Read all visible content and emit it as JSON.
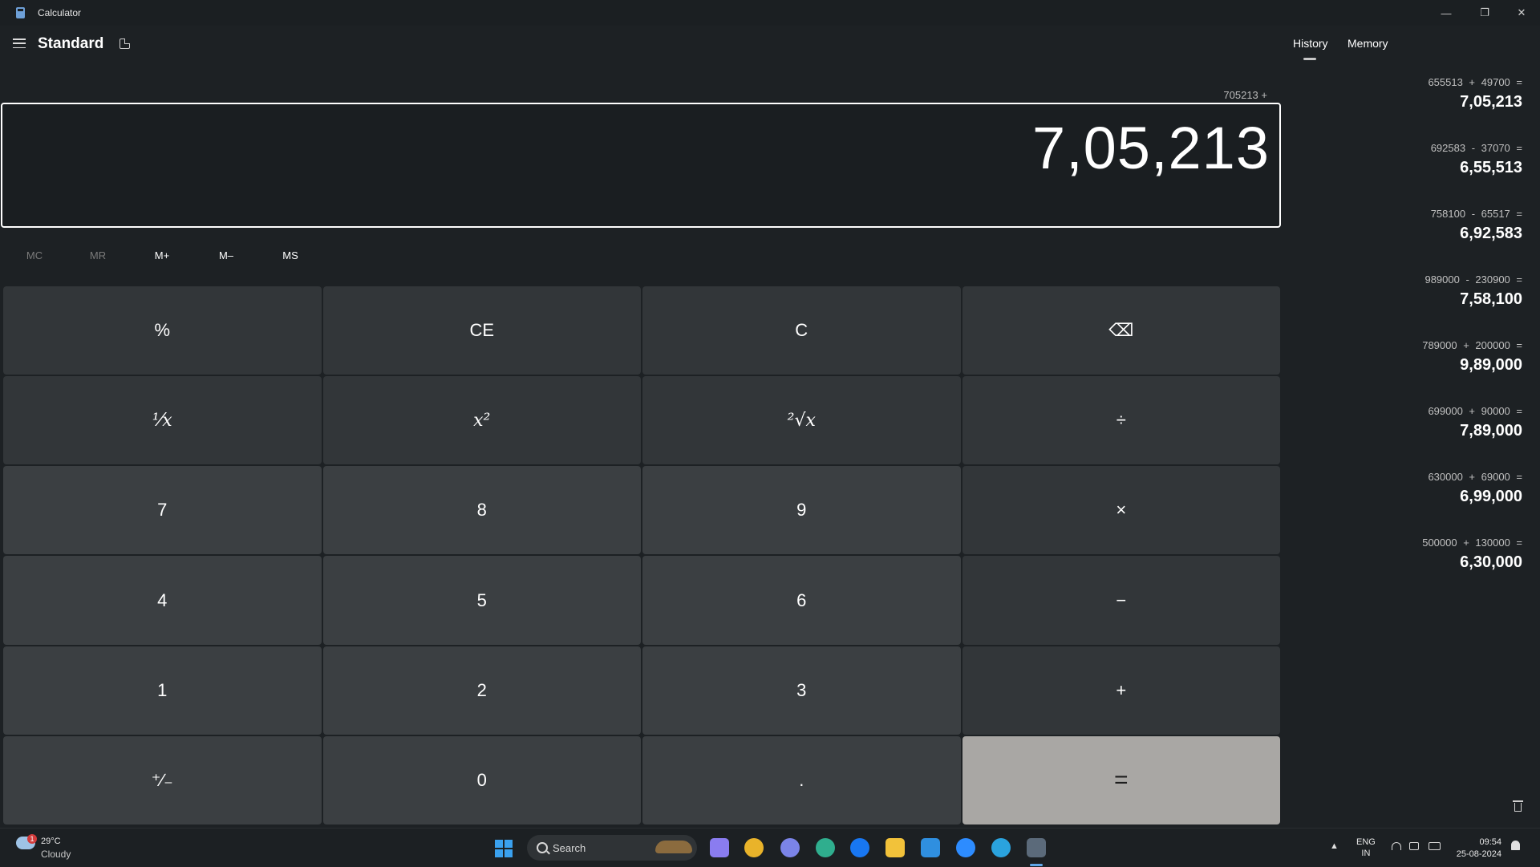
{
  "window": {
    "title": "Calculator",
    "minimize_icon": "—",
    "maximize_icon": "❐",
    "close_icon": "✕"
  },
  "header": {
    "mode": "Standard"
  },
  "display": {
    "expression": "705213 +",
    "value": "7,05,213"
  },
  "memory_buttons": [
    {
      "label": "MC",
      "enabled": false
    },
    {
      "label": "MR",
      "enabled": false
    },
    {
      "label": "M+",
      "enabled": true
    },
    {
      "label": "M–",
      "enabled": true
    },
    {
      "label": "MS",
      "enabled": true
    }
  ],
  "keys": {
    "percent": "%",
    "ce": "CE",
    "clear": "C",
    "backspace": "⌫",
    "reciprocal": "¹⁄x",
    "square": "x²",
    "sqrt": "²√x",
    "divide": "÷",
    "seven": "7",
    "eight": "8",
    "nine": "9",
    "multiply": "×",
    "four": "4",
    "five": "5",
    "six": "6",
    "minus": "−",
    "one": "1",
    "two": "2",
    "three": "3",
    "plus": "+",
    "negate": "⁺∕₋",
    "zero": "0",
    "decimal": ".",
    "equals": "="
  },
  "side_panel": {
    "tabs": [
      "History",
      "Memory"
    ],
    "active_tab": "History",
    "history": [
      {
        "expression": "655513 + 49700 =",
        "result": "7,05,213"
      },
      {
        "expression": "692583 - 37070 =",
        "result": "6,55,513"
      },
      {
        "expression": "758100 - 65517 =",
        "result": "6,92,583"
      },
      {
        "expression": "989000 - 230900 =",
        "result": "7,58,100"
      },
      {
        "expression": "789000 + 200000 =",
        "result": "9,89,000"
      },
      {
        "expression": "699000 + 90000 =",
        "result": "7,89,000"
      },
      {
        "expression": "630000 + 69000 =",
        "result": "6,99,000"
      },
      {
        "expression": "500000 + 130000 =",
        "result": "6,30,000"
      }
    ]
  },
  "taskbar": {
    "weather": {
      "badge": "1",
      "temp": "29°C",
      "condition": "Cloudy"
    },
    "search_placeholder": "Search",
    "apps": [
      {
        "name": "copilot",
        "color": "#8a7cf0"
      },
      {
        "name": "chrome",
        "color": "#e9b32a"
      },
      {
        "name": "ai-hub",
        "color": "#7b84e8"
      },
      {
        "name": "edge",
        "color": "#2fae8e"
      },
      {
        "name": "facebook",
        "color": "#1877f2"
      },
      {
        "name": "file-explorer",
        "color": "#f2c23a"
      },
      {
        "name": "mail",
        "color": "#2f8fe0"
      },
      {
        "name": "zoom",
        "color": "#2d8cff"
      },
      {
        "name": "telegram",
        "color": "#2aa3de"
      },
      {
        "name": "calculator",
        "color": "#5b6a7a"
      }
    ],
    "language": {
      "line1": "ENG",
      "line2": "IN"
    },
    "time": "09:54",
    "date": "25-08-2024"
  }
}
